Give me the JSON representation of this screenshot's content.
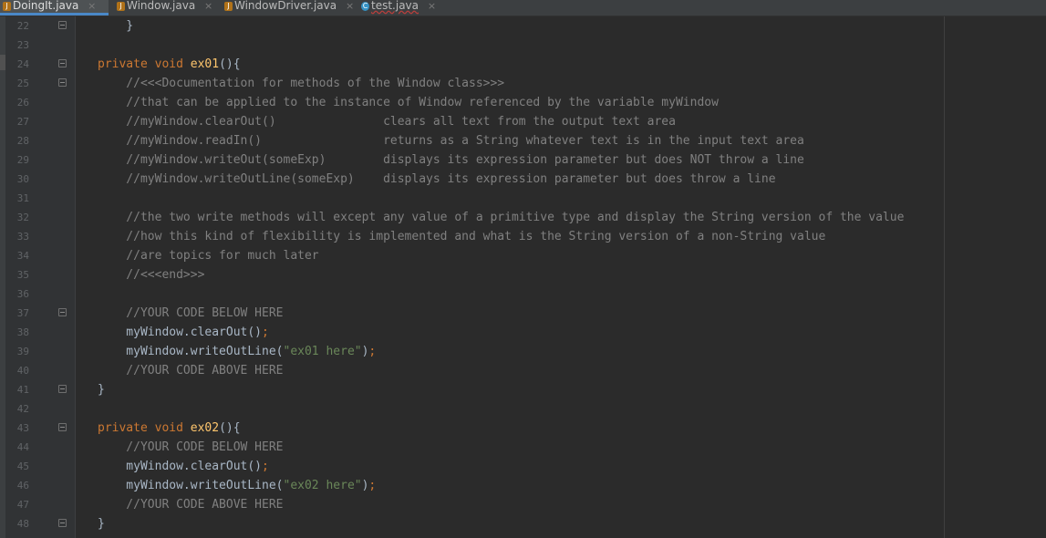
{
  "tabs": [
    {
      "name": "DoingIt.java",
      "close": "×",
      "icon": "java-class-icon",
      "active": true
    },
    {
      "name": "Window.java",
      "close": "×",
      "icon": "java-class-icon",
      "active": false
    },
    {
      "name": "WindowDriver.java",
      "close": "×",
      "icon": "java-class-icon",
      "active": false
    },
    {
      "name": "test.java",
      "close": "×",
      "icon": "java-c-icon",
      "active": false
    }
  ],
  "colors": {
    "keyword": "#cc7832",
    "method": "#ffc66d",
    "comment": "#808080",
    "string": "#6a8759",
    "text": "#a9b7c6",
    "background": "#2b2b2b"
  },
  "lines": [
    {
      "n": "22",
      "fold": true,
      "tokens": [
        [
          "    }",
          "p"
        ]
      ]
    },
    {
      "n": "23",
      "fold": false,
      "tokens": []
    },
    {
      "n": "24",
      "fold": true,
      "tokens": [
        [
          "private",
          "kw"
        ],
        [
          " ",
          "p"
        ],
        [
          "void",
          "kw"
        ],
        [
          " ",
          "p"
        ],
        [
          "ex01",
          "fn"
        ],
        [
          "(){",
          "p"
        ]
      ]
    },
    {
      "n": "25",
      "fold": true,
      "tokens": [
        [
          "    //<<<Documentation for methods of the Window class>>>",
          "cm"
        ]
      ]
    },
    {
      "n": "26",
      "fold": false,
      "tokens": [
        [
          "    //that can be applied to the instance of Window referenced by the variable myWindow",
          "cm"
        ]
      ]
    },
    {
      "n": "27",
      "fold": false,
      "tokens": [
        [
          "    //myWindow.clearOut()               clears all text from the output text area",
          "cm"
        ]
      ]
    },
    {
      "n": "28",
      "fold": false,
      "tokens": [
        [
          "    //myWindow.readIn()                 returns as a String whatever text is in the input text area",
          "cm"
        ]
      ]
    },
    {
      "n": "29",
      "fold": false,
      "tokens": [
        [
          "    //myWindow.writeOut(someExp)        displays its expression parameter but does NOT throw a line",
          "cm"
        ]
      ]
    },
    {
      "n": "30",
      "fold": false,
      "tokens": [
        [
          "    //myWindow.writeOutLine(someExp)    displays its expression parameter but does throw a line",
          "cm"
        ]
      ]
    },
    {
      "n": "31",
      "fold": false,
      "tokens": []
    },
    {
      "n": "32",
      "fold": false,
      "tokens": [
        [
          "    //the two write methods will except any value of a primitive type and display the String version of the value",
          "cm"
        ]
      ]
    },
    {
      "n": "33",
      "fold": false,
      "tokens": [
        [
          "    //how this kind of flexibility is implemented and what is the String version of a non-String value",
          "cm"
        ]
      ]
    },
    {
      "n": "34",
      "fold": false,
      "tokens": [
        [
          "    //are topics for much later",
          "cm"
        ]
      ]
    },
    {
      "n": "35",
      "fold": false,
      "tokens": [
        [
          "    //<<<end>>>",
          "cm"
        ]
      ]
    },
    {
      "n": "36",
      "fold": false,
      "tokens": []
    },
    {
      "n": "37",
      "fold": true,
      "tokens": [
        [
          "    //YOUR CODE BELOW HERE",
          "cm"
        ]
      ]
    },
    {
      "n": "38",
      "fold": false,
      "tokens": [
        [
          "    myWindow.clearOut()",
          "p"
        ],
        [
          ";",
          "kw"
        ]
      ]
    },
    {
      "n": "39",
      "fold": false,
      "tokens": [
        [
          "    myWindow.writeOutLine(",
          "p"
        ],
        [
          "\"ex01 here\"",
          "st"
        ],
        [
          ")",
          "p"
        ],
        [
          ";",
          "kw"
        ]
      ]
    },
    {
      "n": "40",
      "fold": false,
      "tokens": [
        [
          "    //YOUR CODE ABOVE HERE",
          "cm"
        ]
      ]
    },
    {
      "n": "41",
      "fold": true,
      "tokens": [
        [
          "}",
          "p"
        ]
      ]
    },
    {
      "n": "42",
      "fold": false,
      "tokens": []
    },
    {
      "n": "43",
      "fold": true,
      "tokens": [
        [
          "private",
          "kw"
        ],
        [
          " ",
          "p"
        ],
        [
          "void",
          "kw"
        ],
        [
          " ",
          "p"
        ],
        [
          "ex02",
          "fn"
        ],
        [
          "(){",
          "p"
        ]
      ]
    },
    {
      "n": "44",
      "fold": false,
      "tokens": [
        [
          "    //YOUR CODE BELOW HERE",
          "cm"
        ]
      ]
    },
    {
      "n": "45",
      "fold": false,
      "tokens": [
        [
          "    myWindow.clearOut()",
          "p"
        ],
        [
          ";",
          "kw"
        ]
      ]
    },
    {
      "n": "46",
      "fold": false,
      "tokens": [
        [
          "    myWindow.writeOutLine(",
          "p"
        ],
        [
          "\"ex02 here\"",
          "st"
        ],
        [
          ")",
          "p"
        ],
        [
          ";",
          "kw"
        ]
      ]
    },
    {
      "n": "47",
      "fold": false,
      "tokens": [
        [
          "    //YOUR CODE ABOVE HERE",
          "cm"
        ]
      ]
    },
    {
      "n": "48",
      "fold": true,
      "tokens": [
        [
          "}",
          "p"
        ]
      ]
    }
  ]
}
